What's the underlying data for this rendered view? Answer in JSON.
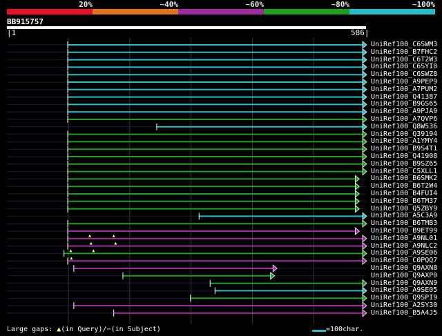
{
  "colors": {
    "background": "#000000",
    "red": "#e8102a",
    "orange": "#e2731a",
    "purple": "#a02ba0",
    "green": "#1ea01e",
    "cyan": "#22c0c8",
    "grid": "#3a3a3a",
    "gap": "#ffff66",
    "backbone": "#1a1a3a"
  },
  "legend": [
    {
      "label": "20%",
      "color": "red"
    },
    {
      "label": "~40%",
      "color": "orange"
    },
    {
      "label": "~60%",
      "color": "purple"
    },
    {
      "label": "~80%",
      "color": "green"
    },
    {
      "label": "~100%",
      "color": "cyan"
    }
  ],
  "query": {
    "id": "BB915757",
    "start_label": "1",
    "end_label": "586",
    "length": 586
  },
  "hits": [
    {
      "id": "UniRef100_C6SWM3",
      "start": 100,
      "end": 586,
      "color": "cyan"
    },
    {
      "id": "UniRef100_B7FHC2",
      "start": 100,
      "end": 586,
      "color": "cyan"
    },
    {
      "id": "UniRef100_C6T2W3",
      "start": 100,
      "end": 586,
      "color": "cyan"
    },
    {
      "id": "UniRef100_C6SYI0",
      "start": 100,
      "end": 586,
      "color": "cyan"
    },
    {
      "id": "UniRef100_C6SWZ8",
      "start": 100,
      "end": 586,
      "color": "cyan"
    },
    {
      "id": "UniRef100_A9PEP9",
      "start": 100,
      "end": 586,
      "color": "cyan"
    },
    {
      "id": "UniRef100_A7PUM2",
      "start": 100,
      "end": 586,
      "color": "cyan"
    },
    {
      "id": "UniRef100_Q41387",
      "start": 100,
      "end": 586,
      "color": "cyan"
    },
    {
      "id": "UniRef100_B9GS65",
      "start": 100,
      "end": 586,
      "color": "cyan"
    },
    {
      "id": "UniRef100_A9PJA9",
      "start": 100,
      "end": 586,
      "color": "cyan"
    },
    {
      "id": "UniRef100_A7QVP6",
      "start": 100,
      "end": 586,
      "color": "green"
    },
    {
      "id": "UniRef100_Q8W536",
      "start": 245,
      "end": 586,
      "color": "cyan"
    },
    {
      "id": "UniRef100_Q39194",
      "start": 100,
      "end": 586,
      "color": "green"
    },
    {
      "id": "UniRef100_A1YMY4",
      "start": 100,
      "end": 586,
      "color": "green"
    },
    {
      "id": "UniRef100_B9S4T1",
      "start": 100,
      "end": 586,
      "color": "green"
    },
    {
      "id": "UniRef100_Q41908",
      "start": 100,
      "end": 586,
      "color": "green"
    },
    {
      "id": "UniRef100_B9SZ65",
      "start": 100,
      "end": 586,
      "color": "green"
    },
    {
      "id": "UniRef100_C5XLL1",
      "start": 100,
      "end": 586,
      "color": "green"
    },
    {
      "id": "UniRef100_B6SMK2",
      "start": 100,
      "end": 574,
      "color": "green"
    },
    {
      "id": "UniRef100_B6T2W4",
      "start": 100,
      "end": 574,
      "color": "green"
    },
    {
      "id": "UniRef100_B4FUI4",
      "start": 100,
      "end": 574,
      "color": "green"
    },
    {
      "id": "UniRef100_B6TM37",
      "start": 100,
      "end": 574,
      "color": "green"
    },
    {
      "id": "UniRef100_Q5ZBY9",
      "start": 100,
      "end": 574,
      "color": "green"
    },
    {
      "id": "UniRef100_A5C3A9",
      "start": 314,
      "end": 586,
      "color": "cyan"
    },
    {
      "id": "UniRef100_B6TMB3",
      "start": 100,
      "end": 586,
      "color": "green"
    },
    {
      "id": "UniRef100_B9ET99",
      "start": 100,
      "end": 574,
      "color": "purple"
    },
    {
      "id": "UniRef100_A9NL01",
      "start": 100,
      "end": 586,
      "color": "purple",
      "gaps": [
        136,
        175
      ]
    },
    {
      "id": "UniRef100_A9NLC2",
      "start": 100,
      "end": 586,
      "color": "purple",
      "gaps": [
        138,
        178
      ]
    },
    {
      "id": "UniRef100_A9SE06",
      "start": 94,
      "end": 586,
      "color": "green",
      "gaps": [
        105,
        142
      ]
    },
    {
      "id": "UniRef100_C0PQQ7",
      "start": 100,
      "end": 586,
      "color": "purple",
      "gaps": [
        106
      ]
    },
    {
      "id": "UniRef100_Q9AXN8",
      "start": 110,
      "end": 440,
      "color": "purple"
    },
    {
      "id": "UniRef100_Q9AXP0",
      "start": 190,
      "end": 436,
      "color": "green"
    },
    {
      "id": "UniRef100_Q9AXN9",
      "start": 332,
      "end": 586,
      "color": "green"
    },
    {
      "id": "UniRef100_A9SE05",
      "start": 340,
      "end": 586,
      "color": "cyan"
    },
    {
      "id": "UniRef100_Q9SPI9",
      "start": 300,
      "end": 586,
      "color": "green"
    },
    {
      "id": "UniRef100_A2SY30",
      "start": 110,
      "end": 586,
      "color": "purple"
    },
    {
      "id": "UniRef100_B5A4J5",
      "start": 175,
      "end": 586,
      "color": "purple"
    }
  ],
  "footer": {
    "gaps_label": "Large gaps:",
    "query_gap_glyph": "▲",
    "in_query": "(in Query)/",
    "subject_gap_glyph": "−",
    "in_subject": "(in Subject)",
    "scale_label": "=100char."
  }
}
